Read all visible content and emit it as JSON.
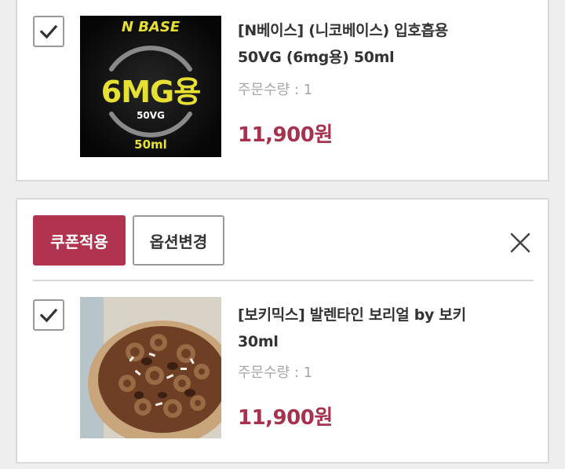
{
  "cart": {
    "items": [
      {
        "name_line1": "[N베이스] (니코베이스) 입호흡용",
        "name_line2": "50VG (6mg용) 50ml",
        "quantity": "주문수량 : 1",
        "price": "11,900원",
        "checked": true,
        "thumb": {
          "brand": "N BASE",
          "strength": "6MG용",
          "vg": "50VG",
          "volume": "50ml"
        }
      },
      {
        "name_line1": "[보키믹스] 발렌타인 보리얼 by 보키",
        "name_line2": "30ml",
        "quantity": "주문수량 : 1",
        "price": "11,900원",
        "checked": true
      }
    ],
    "actions": {
      "coupon_label": "쿠폰적용",
      "option_label": "옵션변경"
    }
  },
  "colors": {
    "accent": "#b0334f",
    "price": "#a6324d",
    "border": "#d9d9d9",
    "text": "#333333",
    "muted": "#a6a6a6"
  }
}
